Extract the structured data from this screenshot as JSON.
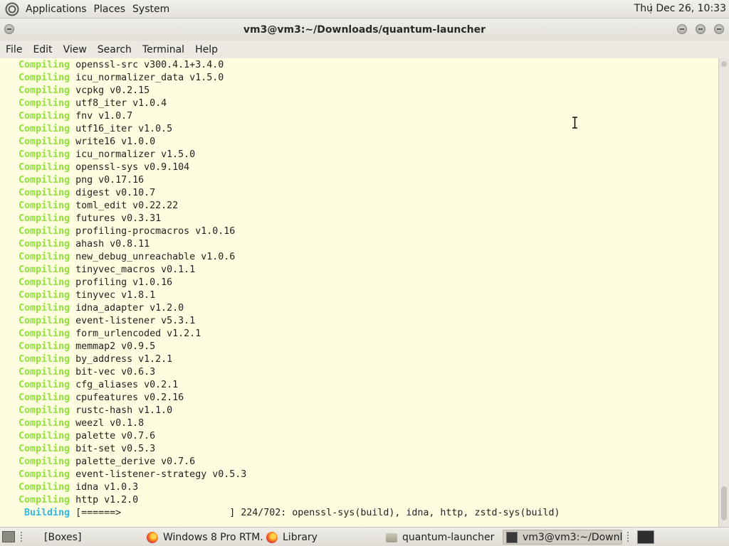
{
  "top_panel": {
    "menus": [
      "Applications",
      "Places",
      "System"
    ],
    "clock": "Thu Dec 26, 10:33"
  },
  "window": {
    "title": "vm3@vm3:~/Downloads/quantum-launcher"
  },
  "menubar": [
    "File",
    "Edit",
    "View",
    "Search",
    "Terminal",
    "Help"
  ],
  "terminal": {
    "compile_keyword": "Compiling",
    "lines": [
      "openssl-src v300.4.1+3.4.0",
      "icu_normalizer_data v1.5.0",
      "vcpkg v0.2.15",
      "utf8_iter v1.0.4",
      "fnv v1.0.7",
      "utf16_iter v1.0.5",
      "write16 v1.0.0",
      "icu_normalizer v1.5.0",
      "openssl-sys v0.9.104",
      "png v0.17.16",
      "digest v0.10.7",
      "toml_edit v0.22.22",
      "futures v0.3.31",
      "profiling-procmacros v1.0.16",
      "ahash v0.8.11",
      "new_debug_unreachable v1.0.6",
      "tinyvec_macros v0.1.1",
      "profiling v1.0.16",
      "tinyvec v1.8.1",
      "idna_adapter v1.2.0",
      "event-listener v5.3.1",
      "form_urlencoded v1.2.1",
      "memmap2 v0.9.5",
      "by_address v1.2.1",
      "bit-vec v0.6.3",
      "cfg_aliases v0.2.1",
      "cpufeatures v0.2.16",
      "rustc-hash v1.1.0",
      "weezl v0.1.8",
      "palette v0.7.6",
      "bit-set v0.5.3",
      "palette_derive v0.7.6",
      "event-listener-strategy v0.5.3",
      "idna v1.0.3",
      "http v1.2.0"
    ],
    "build_keyword": "Building",
    "build_status": "[======>                   ] 224/702: openssl-sys(build), idna, http, zstd-sys(build)"
  },
  "taskbar": {
    "tasks": [
      {
        "label": "[Boxes]",
        "icon": "none"
      },
      {
        "label": "Windows 8 Pro RTM...",
        "icon": "firefox-icon"
      },
      {
        "label": "Library",
        "icon": "firefox-icon"
      },
      {
        "label": "quantum-launcher",
        "icon": "folder-icon"
      },
      {
        "label": "vm3@vm3:~/Downl...",
        "icon": "terminal-icon"
      }
    ]
  },
  "colors": {
    "terminal_bg": "#fffde0",
    "compiling": "#8ee23a",
    "building": "#30b8e8"
  }
}
